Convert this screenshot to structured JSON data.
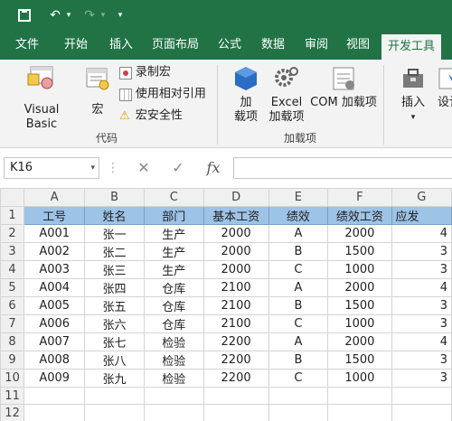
{
  "ribbon_tabs": [
    "文件",
    "开始",
    "插入",
    "页面布局",
    "公式",
    "数据",
    "审阅",
    "视图",
    "开发工具"
  ],
  "active_tab": "开发工具",
  "ribbon": {
    "code_group": {
      "label": "代码",
      "visual_basic": "Visual Basic",
      "macros": "宏",
      "record_macro": "录制宏",
      "relative_ref": "使用相对引用",
      "macro_security": "宏安全性"
    },
    "addins_group": {
      "label": "加载项",
      "addins_line1": "加",
      "addins_line2": "载项",
      "excel_addins_line1": "Excel",
      "excel_addins_line2": "加载项",
      "com_addins": "COM 加载项"
    },
    "insert_label": "插入",
    "design_label": "设计"
  },
  "formula_bar": {
    "name_box": "K16",
    "cancel": "✕",
    "enter": "✓",
    "fx": "fx",
    "formula": ""
  },
  "sheet": {
    "columns": [
      "A",
      "B",
      "C",
      "D",
      "E",
      "F",
      "G"
    ],
    "row_numbers": [
      "1",
      "2",
      "3",
      "4",
      "5",
      "6",
      "7",
      "8",
      "9",
      "10",
      "11",
      "12"
    ],
    "header_row": [
      "工号",
      "姓名",
      "部门",
      "基本工资",
      "绩效",
      "绩效工资",
      "应发"
    ],
    "rows": [
      [
        "A001",
        "张一",
        "生产",
        "2000",
        "A",
        "2000",
        "4"
      ],
      [
        "A002",
        "张二",
        "生产",
        "2000",
        "B",
        "1500",
        "3"
      ],
      [
        "A003",
        "张三",
        "生产",
        "2000",
        "C",
        "1000",
        "3"
      ],
      [
        "A004",
        "张四",
        "仓库",
        "2100",
        "A",
        "2000",
        "4"
      ],
      [
        "A005",
        "张五",
        "仓库",
        "2100",
        "B",
        "1500",
        "3"
      ],
      [
        "A006",
        "张六",
        "仓库",
        "2100",
        "C",
        "1000",
        "3"
      ],
      [
        "A007",
        "张七",
        "检验",
        "2200",
        "A",
        "2000",
        "4"
      ],
      [
        "A008",
        "张八",
        "检验",
        "2200",
        "B",
        "1500",
        "3"
      ],
      [
        "A009",
        "张九",
        "检验",
        "2200",
        "C",
        "1000",
        "3"
      ]
    ]
  },
  "colors": {
    "excel_green": "#217346",
    "header_fill": "#9dc3e6"
  }
}
